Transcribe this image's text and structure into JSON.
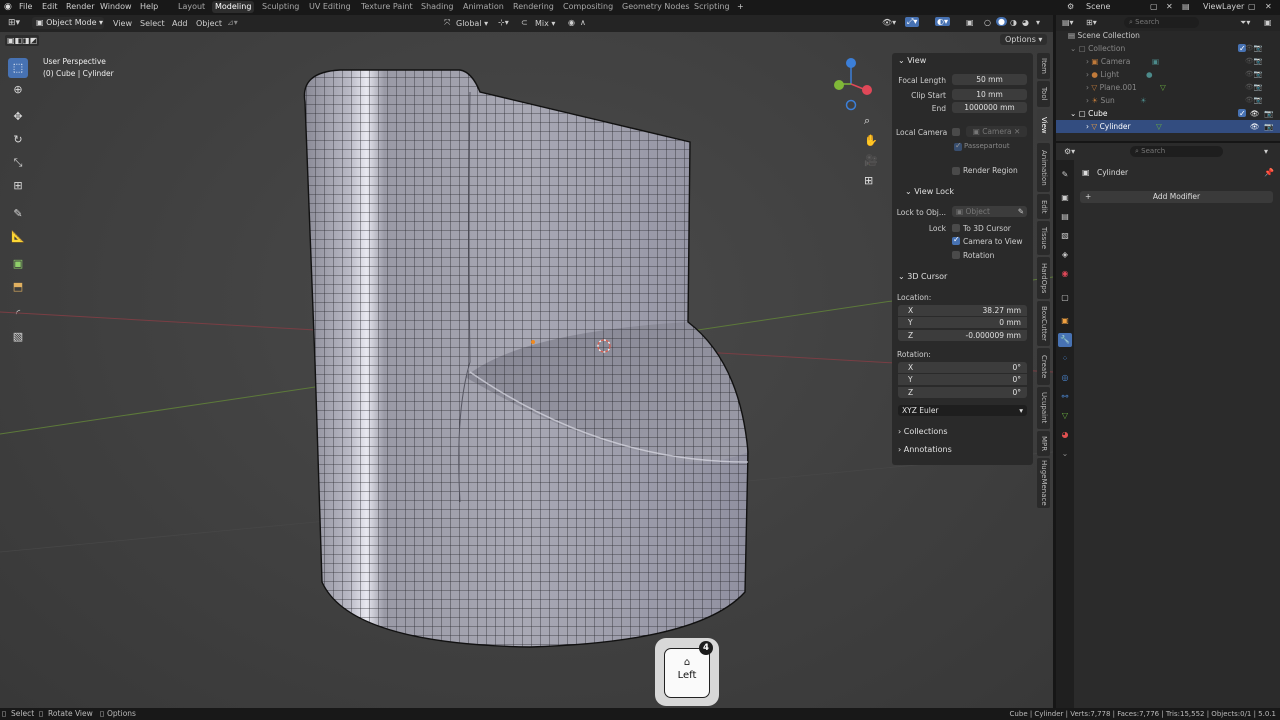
{
  "menu": {
    "items": [
      "File",
      "Edit",
      "Render",
      "Window",
      "Help"
    ],
    "workspaces": [
      "Layout",
      "Modeling",
      "Sculpting",
      "UV Editing",
      "Texture Paint",
      "Shading",
      "Animation",
      "Rendering",
      "Compositing",
      "Geometry Nodes",
      "Scripting"
    ],
    "active_workspace": "Modeling",
    "add_tab": "+",
    "scene": "Scene",
    "view_layer": "ViewLayer"
  },
  "viewport_header": {
    "mode": "Object Mode",
    "menus": [
      "View",
      "Select",
      "Add",
      "Object"
    ],
    "transform_orientation": "Global",
    "snap": "Mix",
    "options": "Options"
  },
  "viewport": {
    "perspective": "User Perspective",
    "collection_object": "(0) Cube | Cylinder"
  },
  "npanel": {
    "view_title": "View",
    "focal_length_label": "Focal Length",
    "focal_length": "50 mm",
    "clip_start_label": "Clip Start",
    "clip_start": "10 mm",
    "end_label": "End",
    "end": "1000000 mm",
    "local_camera_label": "Local Camera",
    "camera_placeholder": "Camera",
    "passepartout": "Passepartout",
    "render_region": "Render Region",
    "view_lock_title": "View Lock",
    "lock_to_obj_label": "Lock to Obj...",
    "object_placeholder": "Object",
    "lock_label": "Lock",
    "to_3d_cursor": "To 3D Cursor",
    "camera_to_view": "Camera to View",
    "rotation_chk": "Rotation",
    "cursor_title": "3D Cursor",
    "location_label": "Location:",
    "loc_x_label": "X",
    "loc_x": "38.27 mm",
    "loc_y_label": "Y",
    "loc_y": "0 mm",
    "loc_z_label": "Z",
    "loc_z": "-0.000009 mm",
    "rotation_label": "Rotation:",
    "rot_x_label": "X",
    "rot_x": "0°",
    "rot_y_label": "Y",
    "rot_y": "0°",
    "rot_z_label": "Z",
    "rot_z": "0°",
    "rotation_mode": "XYZ Euler",
    "collections": "Collections",
    "annotations": "Annotations"
  },
  "vtabs": [
    "Item",
    "Tool",
    "View",
    "Animation",
    "Edit",
    "Tissue",
    "HardOps",
    "BoxCutter",
    "Create",
    "Ucupaint",
    "MPR",
    "HugeMenace"
  ],
  "outliner": {
    "search_placeholder": "Search",
    "scene_collection": "Scene Collection",
    "collection": "Collection",
    "items": [
      "Camera",
      "Light",
      "Plane.001",
      "Sun"
    ],
    "cube": "Cube",
    "cylinder": "Cylinder"
  },
  "properties": {
    "search_placeholder": "Search",
    "object_name": "Cylinder",
    "add_modifier": "Add Modifier"
  },
  "statusbar": {
    "select": "Select",
    "rotate_view": "Rotate View",
    "options": "Options",
    "stats": "Cube | Cylinder | Verts:7,778 | Faces:7,776 | Tris:15,552 | Objects:0/1 | 5.0.1"
  },
  "keycast": {
    "key": "Left",
    "count": "4"
  },
  "colors": {
    "accent": "#4772b3",
    "x_axis": "#e04858",
    "y_axis": "#80b838",
    "z_axis": "#3c7fd8"
  }
}
